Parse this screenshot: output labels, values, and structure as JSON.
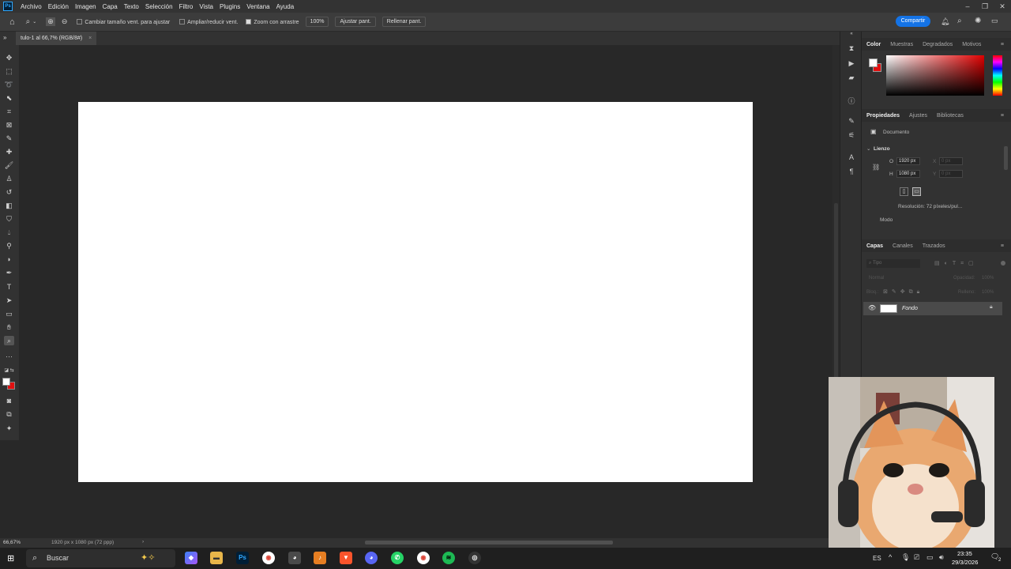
{
  "menubar": {
    "items": [
      "Archivo",
      "Edición",
      "Imagen",
      "Capa",
      "Texto",
      "Selección",
      "Filtro",
      "Vista",
      "Plugins",
      "Ventana",
      "Ayuda"
    ]
  },
  "options": {
    "resize_windows": "Cambiar tamaño vent. para ajustar",
    "zoom_all": "Ampliar/reducir vent.",
    "scrubby_zoom": "Zoom con arrastre",
    "zoom_value": "100%",
    "fit_screen": "Ajustar pant.",
    "fill_screen": "Rellenar pant.",
    "share": "Compartir"
  },
  "document": {
    "tab_title": "tulo-1 al 66,7% (RGB/8#)",
    "close": "×"
  },
  "status": {
    "zoom": "66,67%",
    "info": "1920 px x 1080 px (72 ppp)",
    "arrow": "›"
  },
  "color_panel": {
    "tabs": [
      "Color",
      "Muestras",
      "Degradados",
      "Motivos"
    ],
    "foreground": "#ffffff",
    "background": "#e01010"
  },
  "properties_panel": {
    "tabs": [
      "Propiedades",
      "Ajustes",
      "Bibliotecas"
    ],
    "doc_label": "Documento",
    "section": "Lienzo",
    "w_label": "O",
    "width": "1920 px",
    "h_label": "H",
    "height": "1080 px",
    "x_label": "X",
    "x_value": "0 px",
    "y_label": "Y",
    "y_value": "0 px",
    "resolution": "Resolución: 72 píxeles/pul...",
    "mode": "Modo"
  },
  "layers_panel": {
    "tabs": [
      "Capas",
      "Canales",
      "Trazados"
    ],
    "search": "Tipo",
    "blend": "Normal",
    "opacity_label": "Opacidad:",
    "opacity_value": "100%",
    "lock_label": "Bloq.:",
    "fill_label": "Relleno:",
    "fill_value": "100%",
    "layers": [
      {
        "name": "Fondo"
      }
    ]
  },
  "taskbar": {
    "search": "Buscar",
    "lang": "ES",
    "time": "23:35",
    "date": "29/3/2026",
    "notif": "2"
  }
}
